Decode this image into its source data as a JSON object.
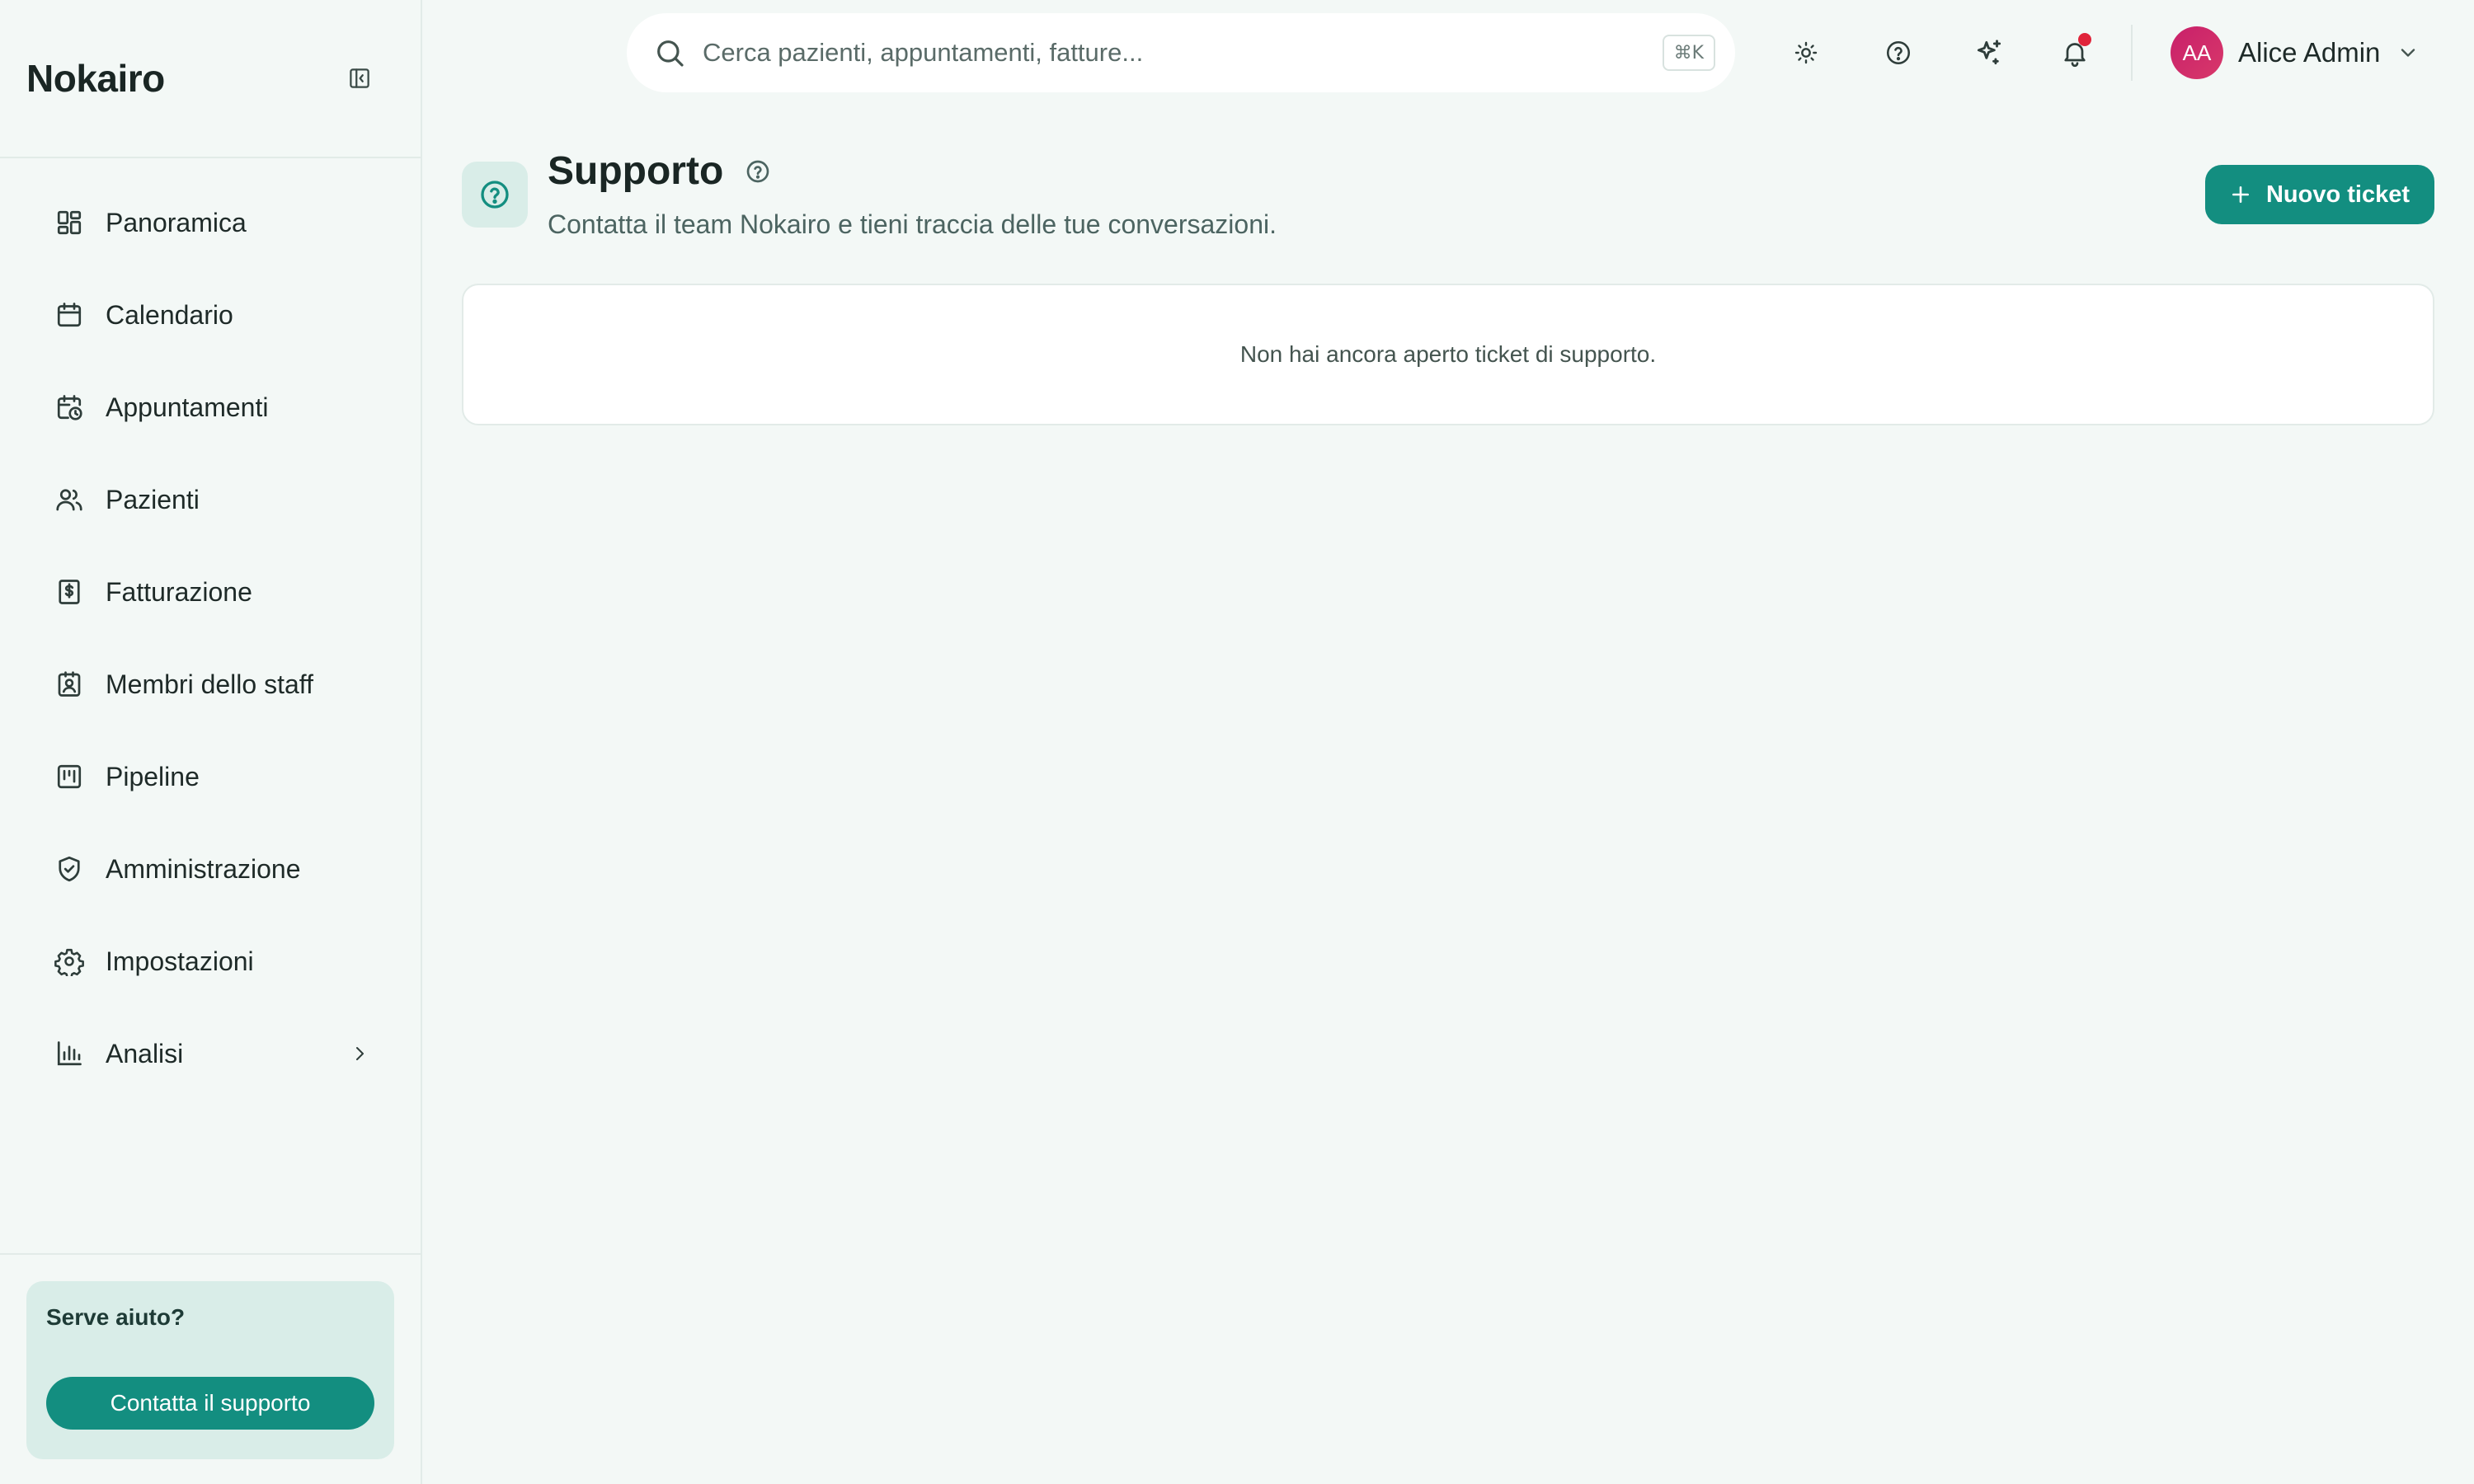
{
  "app": {
    "name": "Nokairo"
  },
  "sidebar": {
    "items": [
      {
        "label": "Panoramica",
        "icon": "dashboard-icon"
      },
      {
        "label": "Calendario",
        "icon": "calendar-icon"
      },
      {
        "label": "Appuntamenti",
        "icon": "calendar-clock-icon"
      },
      {
        "label": "Pazienti",
        "icon": "users-icon"
      },
      {
        "label": "Fatturazione",
        "icon": "receipt-dollar-icon"
      },
      {
        "label": "Membri dello staff",
        "icon": "id-badge-icon"
      },
      {
        "label": "Pipeline",
        "icon": "kanban-icon"
      },
      {
        "label": "Amministrazione",
        "icon": "shield-check-icon"
      },
      {
        "label": "Impostazioni",
        "icon": "gear-icon"
      },
      {
        "label": "Analisi",
        "icon": "bar-chart-icon"
      }
    ],
    "help": {
      "title": "Serve aiuto?",
      "button_label": "Contatta il supporto"
    }
  },
  "header": {
    "search": {
      "placeholder": "Cerca pazienti, appuntamenti, fatture...",
      "value": "",
      "shortcut": "⌘K"
    },
    "user": {
      "initials": "AA",
      "name": "Alice Admin"
    },
    "has_notifications": true
  },
  "page": {
    "title": "Supporto",
    "subtitle": "Contatta il team Nokairo e tieni traccia delle tue conversazioni.",
    "new_ticket_label": "Nuovo ticket",
    "empty_message": "Non hai ancora aperto ticket di supporto."
  },
  "colors": {
    "accent": "#138e80",
    "accent_light": "#d9ede8",
    "background": "#f3f8f6",
    "notification": "#e0243a",
    "avatar": "#c8206a"
  }
}
